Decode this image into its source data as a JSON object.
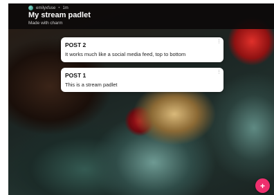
{
  "header": {
    "author": "emilyxfuse",
    "separator": "•",
    "time_ago": "1m",
    "title": "My stream padlet",
    "subtitle": "Made with charm"
  },
  "posts": [
    {
      "title": "POST 2",
      "body": "It works much like a social media feed, top to bottom"
    },
    {
      "title": "POST 1",
      "body": "This is a stream padlet"
    }
  ],
  "icons": {
    "post_menu": "⋮",
    "add": "+"
  },
  "colors": {
    "fab": "#ee2f6e",
    "header_bg": "#0c0a0a",
    "card_bg": "#ffffff"
  }
}
